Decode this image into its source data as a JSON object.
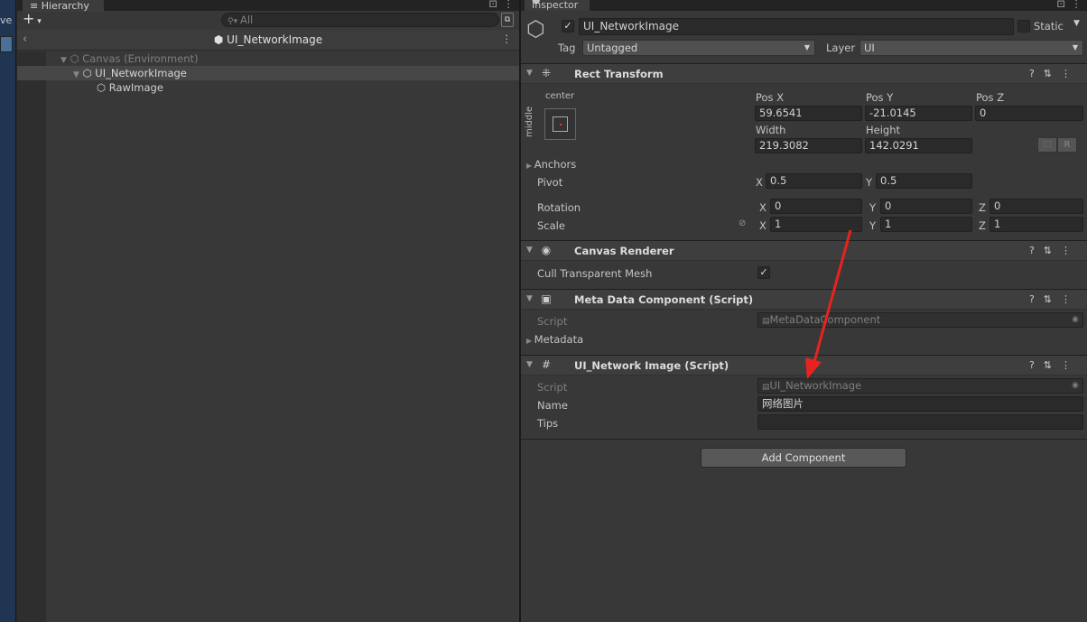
{
  "left_strip": {
    "text": "ve"
  },
  "hierarchy": {
    "tab_label": "Hierarchy",
    "add_label": "+",
    "search_placeholder": "All",
    "scene_title": "UI_NetworkImage",
    "items": [
      {
        "label": "Canvas (Environment)"
      },
      {
        "label": "UI_NetworkImage"
      },
      {
        "label": "RawImage"
      }
    ]
  },
  "inspector": {
    "tab_label": "Inspector",
    "object_name": "UI_NetworkImage",
    "static_label": "Static",
    "tag_label": "Tag",
    "tag_value": "Untagged",
    "layer_label": "Layer",
    "layer_value": "UI",
    "rect": {
      "title": "Rect Transform",
      "anchor_h": "center",
      "anchor_v": "middle",
      "posx_label": "Pos X",
      "posx": "59.6541",
      "posy_label": "Pos Y",
      "posy": "-21.0145",
      "posz_label": "Pos Z",
      "posz": "0",
      "width_label": "Width",
      "width": "219.3082",
      "height_label": "Height",
      "height": "142.0291",
      "r_button": "R",
      "anchors_label": "Anchors",
      "pivot_label": "Pivot",
      "pivot_x": "0.5",
      "pivot_y": "0.5",
      "rotation_label": "Rotation",
      "rot_x": "0",
      "rot_y": "0",
      "rot_z": "0",
      "scale_label": "Scale",
      "scale_x": "1",
      "scale_y": "1",
      "scale_z": "1",
      "x": "X",
      "y": "Y",
      "z": "Z"
    },
    "canvas_renderer": {
      "title": "Canvas Renderer",
      "cull_label": "Cull Transparent Mesh"
    },
    "meta": {
      "title": "Meta Data Component (Script)",
      "script_label": "Script",
      "script_value": "MetaDataComponent",
      "metadata_label": "Metadata"
    },
    "network": {
      "title": "UI_Network Image (Script)",
      "script_label": "Script",
      "script_value": "UI_NetworkImage",
      "name_label": "Name",
      "name_value": "网络图片",
      "tips_label": "Tips",
      "tips_value": ""
    },
    "add_component": "Add Component"
  },
  "annotation_color": "#e8231f"
}
